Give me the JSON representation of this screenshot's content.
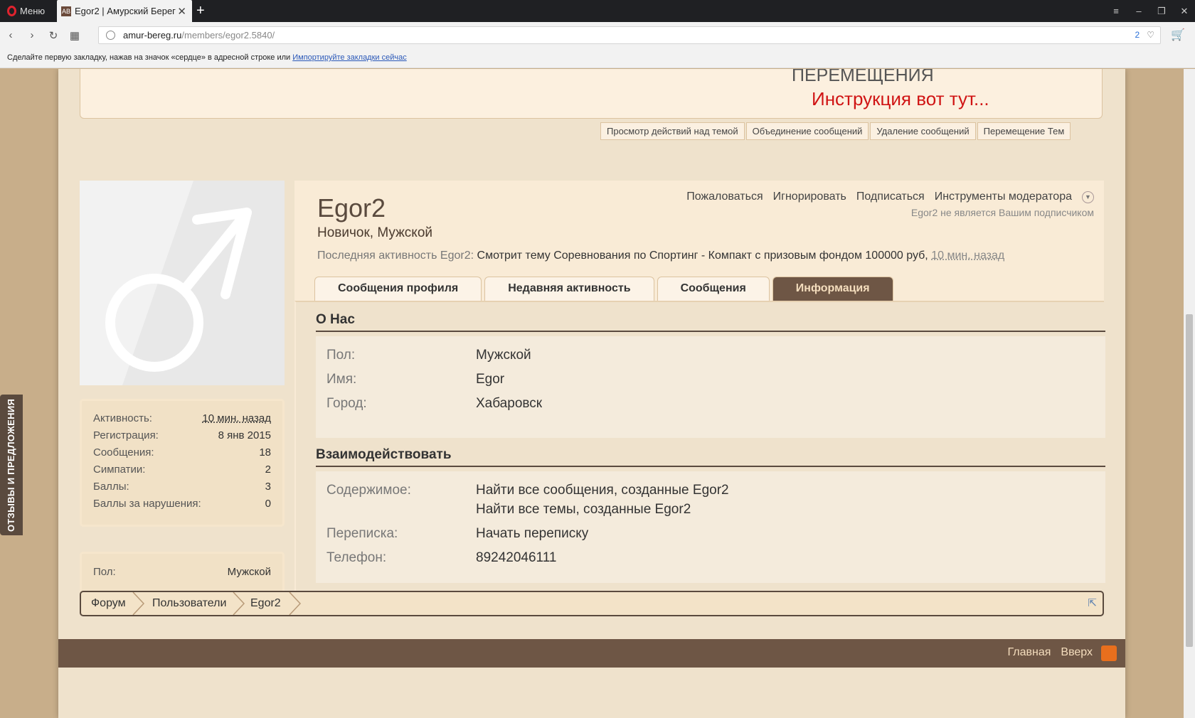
{
  "browser": {
    "menu_label": "Меню",
    "tab_title": "Egor2 | Амурский Берег",
    "new_tab": "+",
    "url_host": "amur-bereg.ru",
    "url_path": "/members/egor2.5840/",
    "badge_count": "2",
    "bookmarks_hint": "Сделайте первую закладку, нажав на значок «сердце» в адресной строке или",
    "bookmarks_link": "Импортируйте закладки сейчас"
  },
  "side_tab": "ОТЗЫВЫ И ПРЕДЛОЖЕНИЯ",
  "notice": {
    "line1": "ПЕРЕМЕЩЕНИЯ",
    "line2": "Инструкция вот тут..."
  },
  "mod_tabs": [
    "Просмотр действий над темой",
    "Объединение сообщений",
    "Удаление сообщений",
    "Перемещение Тем"
  ],
  "stats": [
    {
      "label": "Активность:",
      "value": "10 мин. назад"
    },
    {
      "label": "Регистрация:",
      "value": "8 янв 2015"
    },
    {
      "label": "Сообщения:",
      "value": "18"
    },
    {
      "label": "Симпатии:",
      "value": "2"
    },
    {
      "label": "Баллы:",
      "value": "3"
    },
    {
      "label": "Баллы за нарушения:",
      "value": "0"
    }
  ],
  "gender_box": {
    "label": "Пол:",
    "value": "Мужской"
  },
  "profile": {
    "name": "Egor2",
    "title": "Новичок, Мужской",
    "actions": [
      "Пожаловаться",
      "Игнорировать",
      "Подписаться",
      "Инструменты модератора"
    ],
    "not_subscribed": "Egor2 не является Вашим подписчиком",
    "last_activity_label": "Последняя активность Egor2:",
    "last_activity_text": "Смотрит тему Соревнования по Спортинг - Компакт с призовым фондом 100000 руб,",
    "last_activity_time": "10 мин. назад",
    "tabs": [
      "Сообщения профиля",
      "Недавняя активность",
      "Сообщения",
      "Информация"
    ]
  },
  "about": {
    "heading": "О Нас",
    "rows": [
      {
        "label": "Пол:",
        "value": "Мужской"
      },
      {
        "label": "Имя:",
        "value": "Egor"
      },
      {
        "label": "Город:",
        "value": "Хабаровск"
      }
    ]
  },
  "interact": {
    "heading": "Взаимодействовать",
    "content_label": "Содержимое:",
    "content_links": [
      "Найти все сообщения, созданные Egor2",
      "Найти все темы, созданные Egor2"
    ],
    "conv_label": "Переписка:",
    "conv_link": "Начать переписку",
    "phone_label": "Телефон:",
    "phone_value": "89242046111"
  },
  "breadcrumb": [
    "Форум",
    "Пользователи",
    "Egor2"
  ],
  "footer": {
    "home": "Главная",
    "top": "Вверх"
  },
  "colors": {
    "footer": "#6e5645",
    "active_tab": "#6e5645",
    "notice_red": "#d01414"
  }
}
